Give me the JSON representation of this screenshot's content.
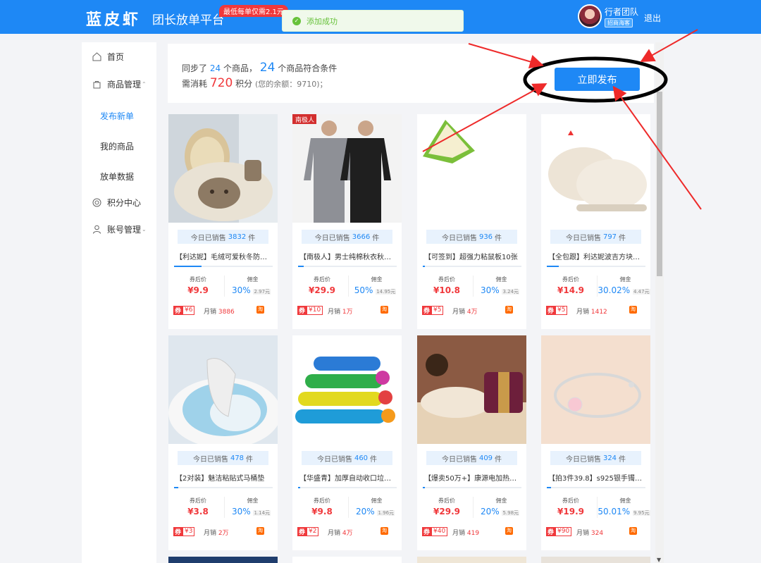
{
  "header": {
    "logo": "蓝皮虾",
    "platform": "团长放单平台",
    "promo": "最低每单仅需2.1元",
    "toast": "添加成功",
    "username": "行者团队",
    "role": "招商海客",
    "logout": "退出"
  },
  "sidebar": {
    "home": "首页",
    "goods_mgmt": "商品管理",
    "publish_new": "发布新单",
    "my_goods": "我的商品",
    "order_data": "放单数据",
    "points_center": "积分中心",
    "account_mgmt": "账号管理"
  },
  "summary": {
    "synced_prefix": "同步了",
    "synced_count": "24",
    "synced_suffix": "个商品，",
    "match_count": "24",
    "match_suffix": "个商品符合条件",
    "cost_prefix": "需消耗",
    "cost_points": "720",
    "cost_suffix": "积分",
    "balance": "(您的余额：9710)；",
    "publish_button": "立即发布"
  },
  "labels": {
    "sold_today": "今日已销售",
    "unit": "件",
    "after_coupon": "券后价",
    "commission": "佣金",
    "coupon_mark": "券",
    "monthly_sales": "月销",
    "taobao_mark": "淘"
  },
  "products": [
    {
      "sold": "3832",
      "title": "【利达妮】毛绒可爱秋冬防滑...",
      "progress": 0.28,
      "price": "¥9.9",
      "rate": "30%",
      "comm_amount": "2.97元",
      "coupon": "¥6",
      "monthly": "3886",
      "image": "slipper-icon"
    },
    {
      "sold": "3666",
      "title": "【南极人】男士纯棉秋衣秋裤...",
      "progress": 0.06,
      "price": "¥29.9",
      "rate": "50%",
      "comm_amount": "14.95元",
      "coupon": "¥10",
      "monthly": "1万",
      "image": "thermal-wear-icon"
    },
    {
      "sold": "936",
      "title": "【可签到】超强力粘鼠板10张",
      "progress": 0.02,
      "price": "¥10.8",
      "rate": "30%",
      "comm_amount": "3.24元",
      "coupon": "¥5",
      "monthly": "4万",
      "image": "mouse-trap-icon"
    },
    {
      "sold": "797",
      "title": "【全包跟】利达妮波吉方块防...",
      "progress": 0.12,
      "price": "¥14.9",
      "rate": "30.02%",
      "comm_amount": "4.47元",
      "coupon": "¥5",
      "monthly": "1412",
      "image": "slipper-icon"
    },
    {
      "sold": "478",
      "title": "【2对装】魅洁粘贴式马桶垫",
      "progress": 0.04,
      "price": "¥3.8",
      "rate": "30%",
      "comm_amount": "1.14元",
      "coupon": "¥3",
      "monthly": "2万",
      "image": "toilet-seat-icon"
    },
    {
      "sold": "460",
      "title": "【华盛青】加厚自动收口垃圾...",
      "progress": 0.02,
      "price": "¥9.8",
      "rate": "20%",
      "comm_amount": "1.96元",
      "coupon": "¥2",
      "monthly": "4万",
      "image": "garbage-bag-icon"
    },
    {
      "sold": "409",
      "title": "【爆卖50万+】康源电加热盐袋",
      "progress": 0.02,
      "price": "¥29.9",
      "rate": "20%",
      "comm_amount": "5.98元",
      "coupon": "¥40",
      "monthly": "419",
      "image": "heating-pad-icon"
    },
    {
      "sold": "324",
      "title": "【拍3件39.8】s925银手镯顶...",
      "progress": 0.04,
      "price": "¥19.9",
      "rate": "50.01%",
      "comm_amount": "9.95元",
      "coupon": "¥90",
      "monthly": "324",
      "image": "bracelet-icon"
    }
  ],
  "colors": {
    "brand": "#1e88f5",
    "price_red": "#f0383b",
    "annotation_red": "#ee2a2a"
  }
}
